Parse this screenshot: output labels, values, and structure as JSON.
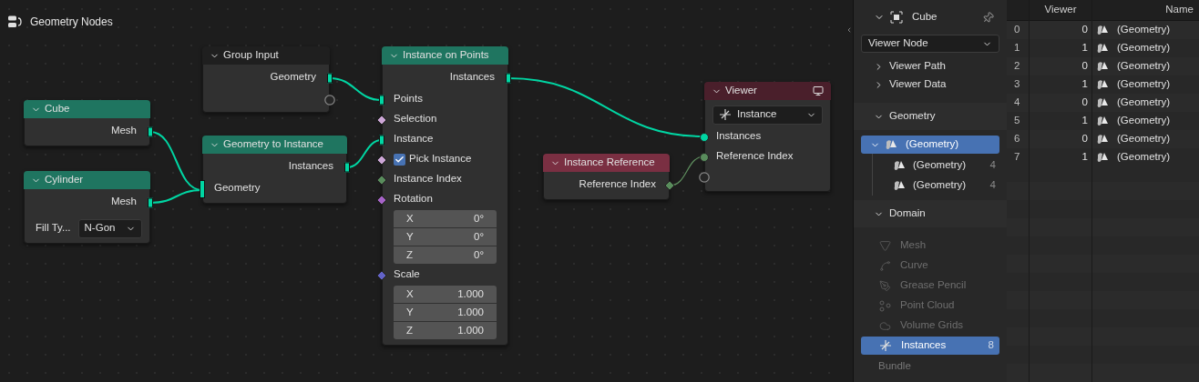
{
  "editor": {
    "title": "Geometry Nodes"
  },
  "nodes": [
    {
      "title": "Group Input",
      "kind": "group_input",
      "color": "#1f1f1f",
      "rows": [
        {
          "kind": "output",
          "label": "Geometry",
          "socket": {
            "kind": "square",
            "color": "#00d6a3"
          }
        },
        {
          "kind": "empty_output",
          "socket": {
            "kind": "hollow"
          }
        }
      ]
    },
    {
      "title": "Cube",
      "kind": "geometry",
      "color": "#1f7560",
      "rows": [
        {
          "kind": "output",
          "label": "Mesh",
          "socket": {
            "kind": "square",
            "color": "#00d6a3"
          }
        }
      ]
    },
    {
      "title": "Cylinder",
      "kind": "geometry",
      "color": "#1f7560",
      "rows": [
        {
          "kind": "output",
          "label": "Mesh",
          "socket": {
            "kind": "square",
            "color": "#00d6a3"
          }
        },
        {
          "kind": "dropdown",
          "label": "Fill Ty...",
          "value": "N-Gon"
        }
      ]
    },
    {
      "title": "Geometry to Instance",
      "kind": "geometry",
      "color": "#1f7560",
      "rows": [
        {
          "kind": "output",
          "label": "Instances",
          "socket": {
            "kind": "square",
            "color": "#00d6a3"
          }
        },
        {
          "kind": "input",
          "label": "Geometry",
          "socket": {
            "kind": "tall",
            "color": "#00d6a3"
          }
        }
      ]
    },
    {
      "title": "Instance on Points",
      "kind": "geometry",
      "color": "#1f7560",
      "rows": [
        {
          "kind": "output",
          "label": "Instances",
          "socket": {
            "kind": "square",
            "color": "#00d6a3"
          }
        },
        {
          "kind": "input",
          "label": "Points",
          "socket": {
            "kind": "square",
            "color": "#00d6a3"
          }
        },
        {
          "kind": "input",
          "label": "Selection",
          "socket": {
            "kind": "diamond",
            "color": "#cca6d6"
          }
        },
        {
          "kind": "input",
          "label": "Instance",
          "socket": {
            "kind": "square",
            "color": "#00d6a3"
          }
        },
        {
          "kind": "checkbox",
          "label": "Pick Instance",
          "checked": true,
          "socket": {
            "kind": "diamond",
            "color": "#cca6d6"
          }
        },
        {
          "kind": "input",
          "label": "Instance Index",
          "socket": {
            "kind": "diamond",
            "color": "#598c5c"
          }
        },
        {
          "kind": "input",
          "label": "Rotation",
          "socket": {
            "kind": "diamond",
            "color": "#a663c7"
          }
        },
        {
          "kind": "vector",
          "fields": [
            {
              "axis": "X",
              "value": "0°"
            },
            {
              "axis": "Y",
              "value": "0°"
            },
            {
              "axis": "Z",
              "value": "0°"
            }
          ]
        },
        {
          "kind": "input",
          "label": "Scale",
          "socket": {
            "kind": "diamond",
            "color": "#6363c7"
          }
        },
        {
          "kind": "vector",
          "fields": [
            {
              "axis": "X",
              "value": "1.000"
            },
            {
              "axis": "Y",
              "value": "1.000"
            },
            {
              "axis": "Z",
              "value": "1.000"
            }
          ]
        }
      ]
    },
    {
      "title": "Instance Reference",
      "kind": "input_node",
      "color": "#7a2f42",
      "rows": [
        {
          "kind": "output",
          "label": "Reference Index",
          "socket": {
            "kind": "diamond",
            "color": "#598c5c"
          }
        }
      ]
    },
    {
      "title": "Viewer",
      "kind": "viewer",
      "color": "#4a1f2b",
      "rows": [
        {
          "kind": "dropdown",
          "value": "Instance"
        },
        {
          "kind": "input",
          "label": "Instances",
          "socket": {
            "kind": "dot",
            "color": "#00d6a3"
          }
        },
        {
          "kind": "input",
          "label": "Reference Index",
          "socket": {
            "kind": "dot",
            "color": "#598c5c"
          }
        },
        {
          "kind": "empty_input",
          "socket": {
            "kind": "hollow"
          }
        }
      ]
    }
  ],
  "sidebar": {
    "object": "Cube",
    "dropdown": "Viewer Node",
    "panels": [
      {
        "label": "Viewer Path",
        "expanded": false
      },
      {
        "label": "Viewer Data",
        "expanded": false
      }
    ],
    "geometry": {
      "label": "Geometry",
      "expanded": true,
      "tree": [
        {
          "label": "(Geometry)",
          "selected": true,
          "expanded": true,
          "children": [
            {
              "label": "(Geometry)",
              "count": "4",
              "selected": false
            },
            {
              "label": "(Geometry)",
              "count": "4",
              "selected": false
            }
          ]
        }
      ]
    },
    "domain": {
      "label": "Domain",
      "expanded": true,
      "items": [
        {
          "kind": "mesh",
          "label": "Mesh",
          "disabled": true,
          "selected": false
        },
        {
          "kind": "curve",
          "label": "Curve",
          "disabled": true,
          "selected": false
        },
        {
          "kind": "grease_pencil",
          "label": "Grease Pencil",
          "disabled": true,
          "selected": false
        },
        {
          "kind": "point_cloud",
          "label": "Point Cloud",
          "disabled": true,
          "selected": false
        },
        {
          "kind": "volume",
          "label": "Volume Grids",
          "disabled": true,
          "selected": false
        },
        {
          "kind": "instances",
          "label": "Instances",
          "count": "8",
          "disabled": false,
          "selected": true
        }
      ]
    },
    "bundle": {
      "label": "Bundle",
      "disabled": true
    }
  },
  "table": {
    "columns": [
      "Viewer",
      "Name"
    ],
    "rows": [
      {
        "index": "0",
        "viewer": "0",
        "name": "(Geometry)"
      },
      {
        "index": "1",
        "viewer": "1",
        "name": "(Geometry)"
      },
      {
        "index": "2",
        "viewer": "0",
        "name": "(Geometry)"
      },
      {
        "index": "3",
        "viewer": "1",
        "name": "(Geometry)"
      },
      {
        "index": "4",
        "viewer": "0",
        "name": "(Geometry)"
      },
      {
        "index": "5",
        "viewer": "1",
        "name": "(Geometry)"
      },
      {
        "index": "6",
        "viewer": "0",
        "name": "(Geometry)"
      },
      {
        "index": "7",
        "viewer": "1",
        "name": "(Geometry)"
      }
    ]
  }
}
